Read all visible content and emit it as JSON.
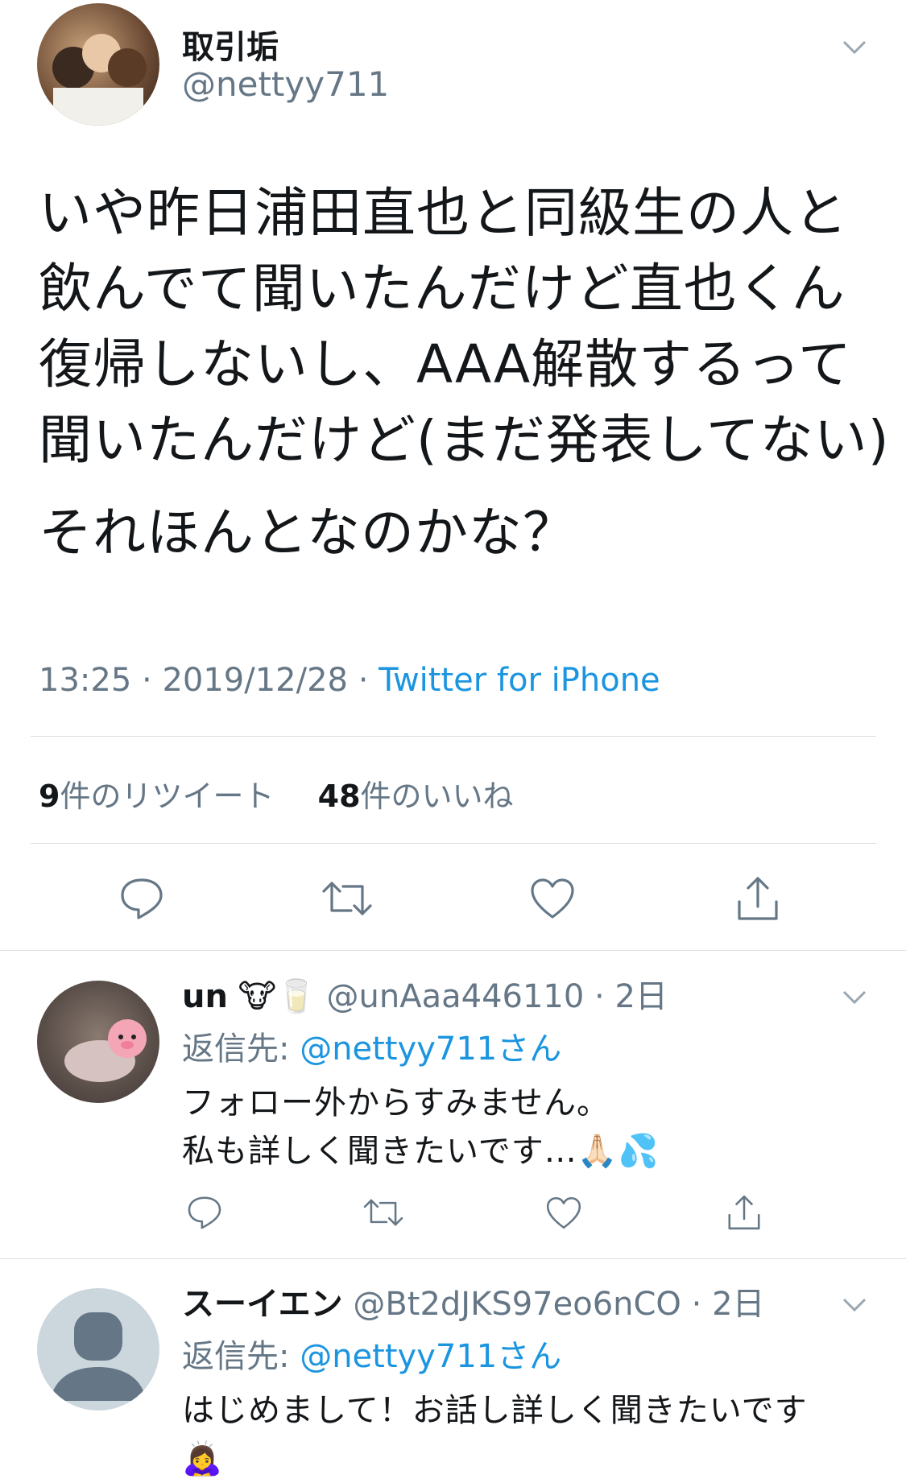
{
  "main_tweet": {
    "author_name": "取引垢",
    "author_handle": "@nettyy711",
    "text_lines": [
      "いや昨日浦田直也と同級生の人と",
      "飲んでて聞いたんだけど直也くん",
      "復帰しないし、AAA解散するって",
      "聞いたんだけど(まだ発表してない)"
    ],
    "text_last": "それほんとなのかな？",
    "time": "13:25",
    "date": "2019/12/28",
    "source": "Twitter for iPhone",
    "retweet_count": "9",
    "retweet_label": "件のリツイート",
    "like_count": "48",
    "like_label": "件のいいね"
  },
  "replies": [
    {
      "name": "un",
      "name_emoji": "🐮🥛",
      "handle": "@unAaa446110",
      "age": "2日",
      "reply_to_label": "返信先: ",
      "reply_to_user": "@nettyy711さん",
      "text_lines": [
        "フォロー外からすみません。",
        "私も詳しく聞きたいです…🙏🏻💦"
      ]
    },
    {
      "name": "スーイエン",
      "handle": "@Bt2dJKS97eo6nCO",
      "age": "2日",
      "reply_to_label": "返信先: ",
      "reply_to_user": "@nettyy711さん",
      "text_lines": [
        "はじめまして！お話し詳しく聞きたいです",
        "🙇‍♀️"
      ]
    }
  ],
  "icons": [
    "chevron-down-icon",
    "reply-icon",
    "retweet-icon",
    "like-icon",
    "share-icon",
    "default-avatar-icon"
  ],
  "colors": {
    "link": "#1b95e0",
    "muted": "#657786",
    "divider": "#dadfe3"
  }
}
